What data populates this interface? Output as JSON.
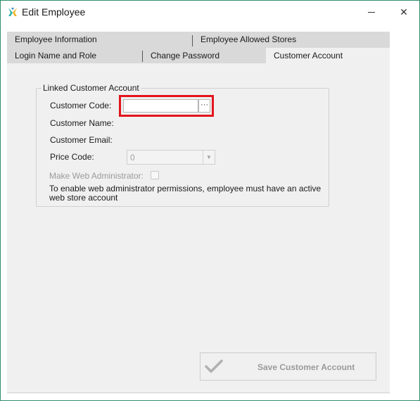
{
  "window": {
    "title": "Edit Employee",
    "minimize_label": "—",
    "close_label": "✕",
    "border_color": "#2f8f6a"
  },
  "tabs": {
    "row1": [
      "Employee Information",
      "Employee Allowed Stores"
    ],
    "row2": [
      "Login Name and Role",
      "Change Password",
      "Customer Account"
    ],
    "active": "Customer Account"
  },
  "linked_account": {
    "legend": "Linked Customer Account",
    "customer_code_label": "Customer Code:",
    "customer_code_value": "",
    "browse_button_label": "···",
    "customer_name_label": "Customer Name:",
    "customer_email_label": "Customer Email:",
    "price_code_label": "Price Code:",
    "price_code_value": "0",
    "make_web_admin_label": "Make Web Administrator:",
    "make_web_admin_checked": false,
    "note": "To enable web administrator permissions, employee must have an active web store account",
    "highlight_color": "#e3141c"
  },
  "footer": {
    "save_button_label": "Save Customer Account"
  }
}
